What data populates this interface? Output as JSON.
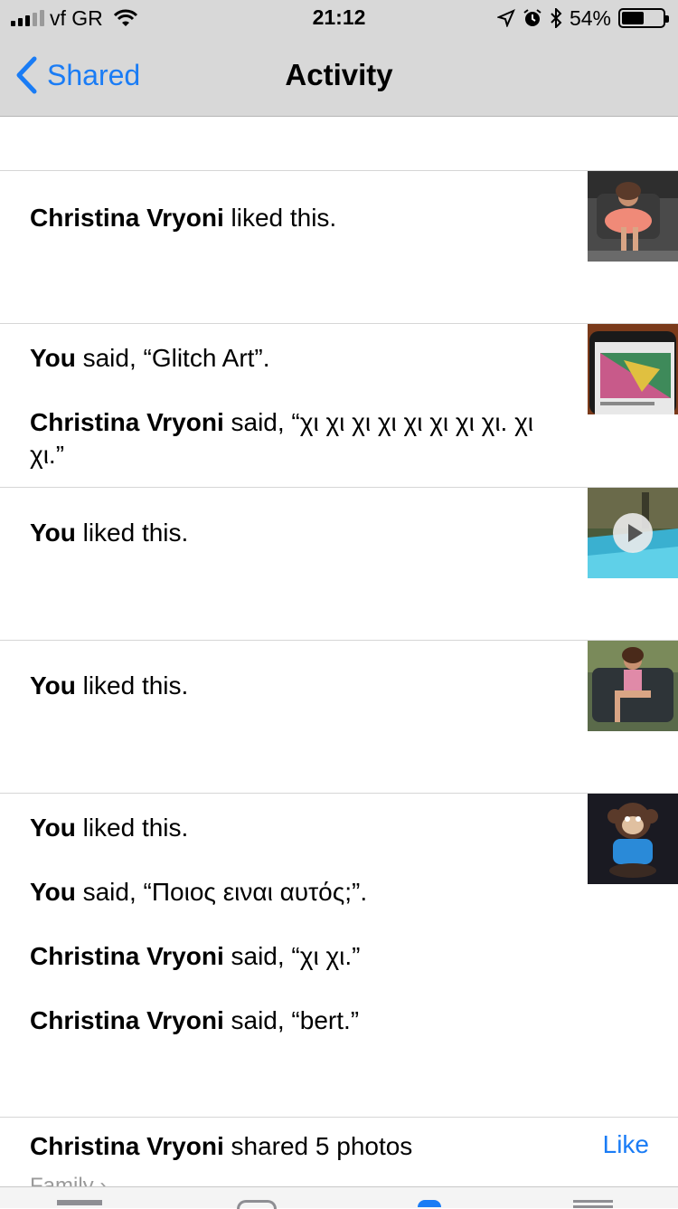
{
  "status_bar": {
    "carrier": "vf GR",
    "time": "21:12",
    "battery": "54%",
    "battery_level": 0.54
  },
  "nav": {
    "back_label": "Shared",
    "title": "Activity"
  },
  "feed": [
    {
      "lines": [
        {
          "name": "Christina Vryoni",
          "text": " liked this."
        }
      ]
    },
    {
      "lines": [
        {
          "name": "You",
          "text": " said, “Glitch Art”."
        },
        {
          "name": "Christina Vryoni",
          "text": " said, “χι χι χι χι χι χι χι χι. χι χι.”"
        }
      ]
    },
    {
      "lines": [
        {
          "name": "You",
          "text": " liked this."
        }
      ],
      "video": true
    },
    {
      "lines": [
        {
          "name": "You",
          "text": " liked this."
        }
      ]
    },
    {
      "lines": [
        {
          "name": "You",
          "text": " liked this."
        },
        {
          "name": "You",
          "text": " said, “Ποιος ειναι αυτός;”."
        },
        {
          "name": "Christina Vryoni",
          "text": " said, “χι χι.”"
        },
        {
          "name": "Christina Vryoni",
          "text": " said, “bert.”"
        }
      ]
    }
  ],
  "shared_item": {
    "name": "Christina Vryoni",
    "text": " shared 5 photos",
    "like_label": "Like",
    "album": "Family"
  },
  "colors": {
    "accent": "#1a7cf5",
    "bar_bg": "#d8d8d8",
    "divider": "#d6d6d6"
  }
}
